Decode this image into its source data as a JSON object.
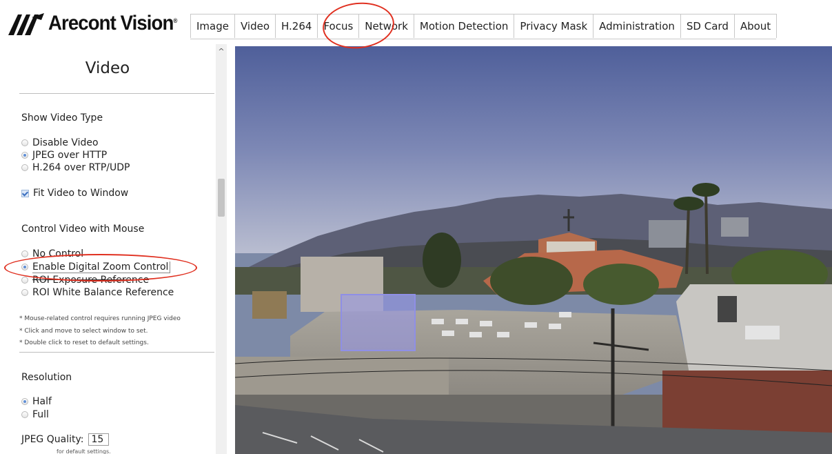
{
  "logo": {
    "text": "Arecont Vision",
    "mark": "®"
  },
  "tabs": [
    {
      "label": "Image"
    },
    {
      "label": "Video"
    },
    {
      "label": "H.264"
    },
    {
      "label": "Focus"
    },
    {
      "label": "Network"
    },
    {
      "label": "Motion Detection"
    },
    {
      "label": "Privacy Mask"
    },
    {
      "label": "Administration"
    },
    {
      "label": "SD Card"
    },
    {
      "label": "About"
    }
  ],
  "sidebar": {
    "title": "Video",
    "show_video_type": {
      "label": "Show Video Type",
      "options": [
        {
          "label": "Disable Video",
          "selected": false
        },
        {
          "label": "JPEG over HTTP",
          "selected": true
        },
        {
          "label": "H.264 over RTP/UDP",
          "selected": false
        }
      ]
    },
    "fit_video": {
      "label": "Fit Video to Window",
      "checked": true
    },
    "control_video": {
      "label": "Control Video with Mouse",
      "options": [
        {
          "label": "No Control",
          "selected": false
        },
        {
          "label": "Enable Digital Zoom Control",
          "selected": true
        },
        {
          "label": "ROI Exposure Reference",
          "selected": false
        },
        {
          "label": "ROI White Balance Reference",
          "selected": false
        }
      ]
    },
    "notes": [
      "* Mouse-related control requires running JPEG video",
      "* Click and move to select window to set.",
      "* Double click to reset to default settings."
    ],
    "resolution": {
      "label": "Resolution",
      "options": [
        {
          "label": "Half",
          "selected": true
        },
        {
          "label": "Full",
          "selected": false
        }
      ]
    },
    "jpeg_quality": {
      "label": "JPEG Quality:",
      "value": "15"
    },
    "hint": "for default settings."
  },
  "colors": {
    "annotation": "#e03020",
    "accent_radio": "#5f8fd6",
    "zoom_box": "#8f8fe6"
  },
  "icons": {
    "scroll_up": "chevron-up-icon",
    "logo": "arecont-vision-logo"
  }
}
